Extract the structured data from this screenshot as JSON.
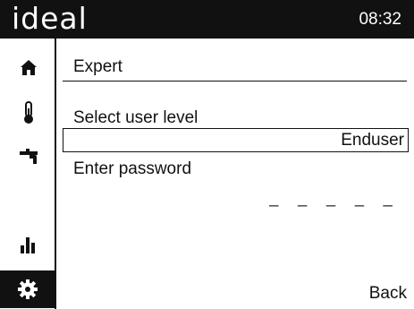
{
  "header": {
    "logo": "ideal",
    "time": "08:32"
  },
  "sidebar": {
    "items": [
      {
        "name": "home",
        "icon": "home-icon"
      },
      {
        "name": "temperature",
        "icon": "thermometer-icon"
      },
      {
        "name": "hot-water",
        "icon": "tap-icon"
      },
      {
        "name": "statistics",
        "icon": "bar-chart-icon"
      },
      {
        "name": "settings",
        "icon": "gear-icon",
        "active": true
      }
    ]
  },
  "main": {
    "section_title": "Expert",
    "user_level": {
      "label": "Select user level",
      "value": "Enduser"
    },
    "password": {
      "label": "Enter password",
      "placeholder": "– – – – –"
    },
    "back_label": "Back"
  },
  "colors": {
    "header_bg": "#111111",
    "header_text": "#ffffff",
    "background": "#ffffff"
  }
}
